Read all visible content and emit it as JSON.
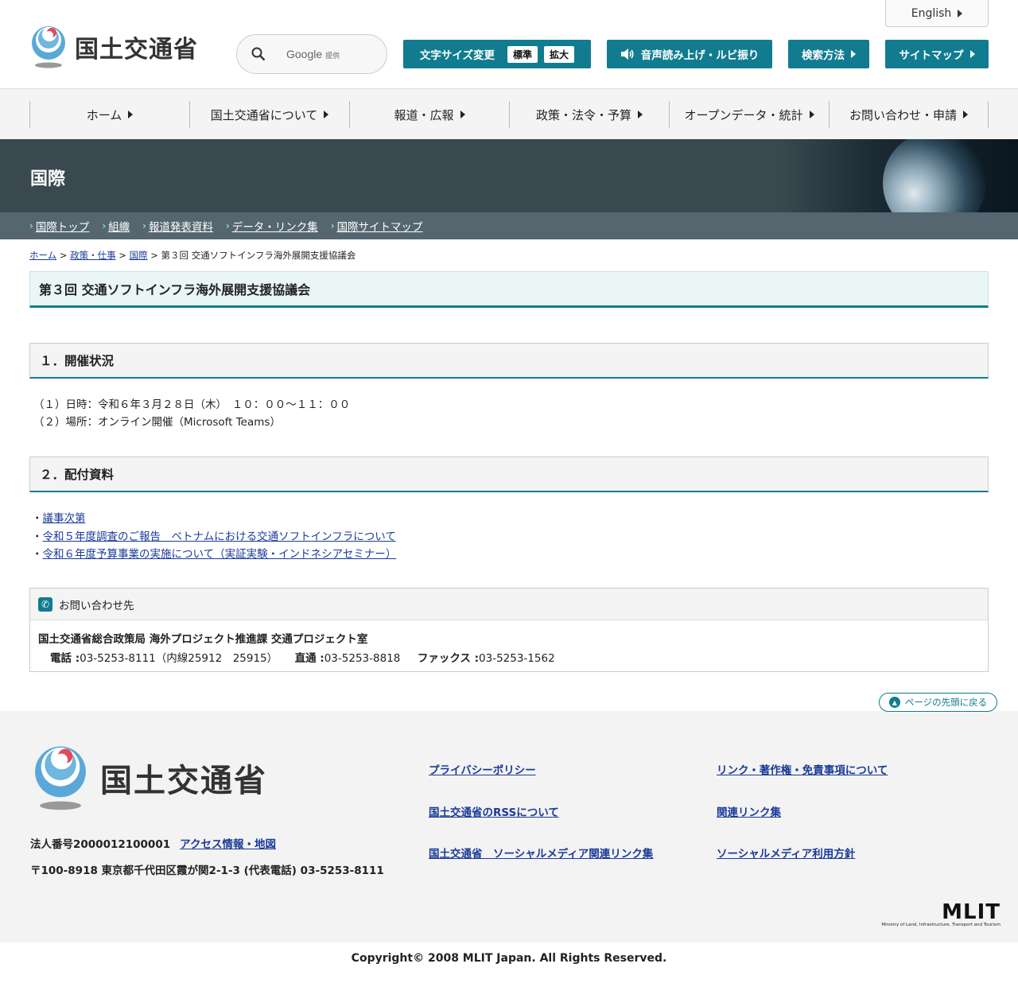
{
  "header": {
    "site_name": "国土交通省",
    "search_label": "Google",
    "search_suffix": "提供",
    "english_label": "English",
    "font_size_label": "文字サイズ変更",
    "font_standard": "標準",
    "font_large": "拡大",
    "speech_label": "音声読み上げ・ルビ振り",
    "search_method_label": "検索方法",
    "sitemap_label": "サイトマップ"
  },
  "gnav": [
    {
      "label": "ホーム"
    },
    {
      "label": "国土交通省について"
    },
    {
      "label": "報道・広報"
    },
    {
      "label": "政策・法令・予算"
    },
    {
      "label": "オープンデータ・統計"
    },
    {
      "label": "お問い合わせ・申請"
    }
  ],
  "banner": {
    "title": "国際"
  },
  "subnav": [
    {
      "label": "国際トップ"
    },
    {
      "label": "組織"
    },
    {
      "label": "報道発表資料"
    },
    {
      "label": "データ・リンク集"
    },
    {
      "label": "国際サイトマップ"
    }
  ],
  "breadcrumb": {
    "home": "ホーム",
    "policy": "政策・仕事",
    "intl": "国際",
    "current": "第３回 交通ソフトインフラ海外展開支援協議会"
  },
  "page": {
    "title": "第３回 交通ソフトインフラ海外展開支援協議会",
    "section1_title": "１．開催状況",
    "date_line": "（１）日時：令和６年３月２８日（木）　１０：００～１１：００",
    "place_line": "（２）場所：オンライン開催（Microsoft Teams）",
    "section2_title": "２．配付資料",
    "materials": [
      {
        "label": "議事次第"
      },
      {
        "label": "令和５年度調査のご報告　ベトナムにおける交通ソフトインフラについて"
      },
      {
        "label": "令和６年度予算事業の実施について（実証実験・インドネシアセミナー）"
      }
    ]
  },
  "contact": {
    "heading": "お問い合わせ先",
    "org": "国土交通省総合政策局 海外プロジェクト推進課 交通プロジェクト室",
    "tel_label": "電話 :",
    "tel_value": "03-5253-8111（内線25912　25915）",
    "direct_label": "直通 :",
    "direct_value": "03-5253-8818",
    "fax_label": "ファックス :",
    "fax_value": "03-5253-1562"
  },
  "to_top": "ページの先頭に戻る",
  "footer": {
    "site_name": "国土交通省",
    "corp_number": "法人番号2000012100001",
    "access_link": "アクセス情報・地図",
    "address": "〒100-8918 東京都千代田区霞が関2-1-3 (代表電話) 03-5253-8111",
    "links": [
      {
        "label": "プライバシーポリシー"
      },
      {
        "label": "リンク・著作権・免責事項について"
      },
      {
        "label": "国土交通省のRSSについて"
      },
      {
        "label": "関連リンク集"
      },
      {
        "label": "国土交通省　ソーシャルメディア関連リンク集"
      },
      {
        "label": "ソーシャルメディア利用方針"
      }
    ],
    "mlit_logo": "MLIT",
    "mlit_sub": "Ministry of Land, Infrastructure, Transport and Tourism",
    "copyright": "Copyright© 2008 MLIT Japan. All Rights Reserved."
  },
  "colors": {
    "accent": "#117c8f",
    "banner": "#3a4850",
    "subnav": "#556670"
  }
}
